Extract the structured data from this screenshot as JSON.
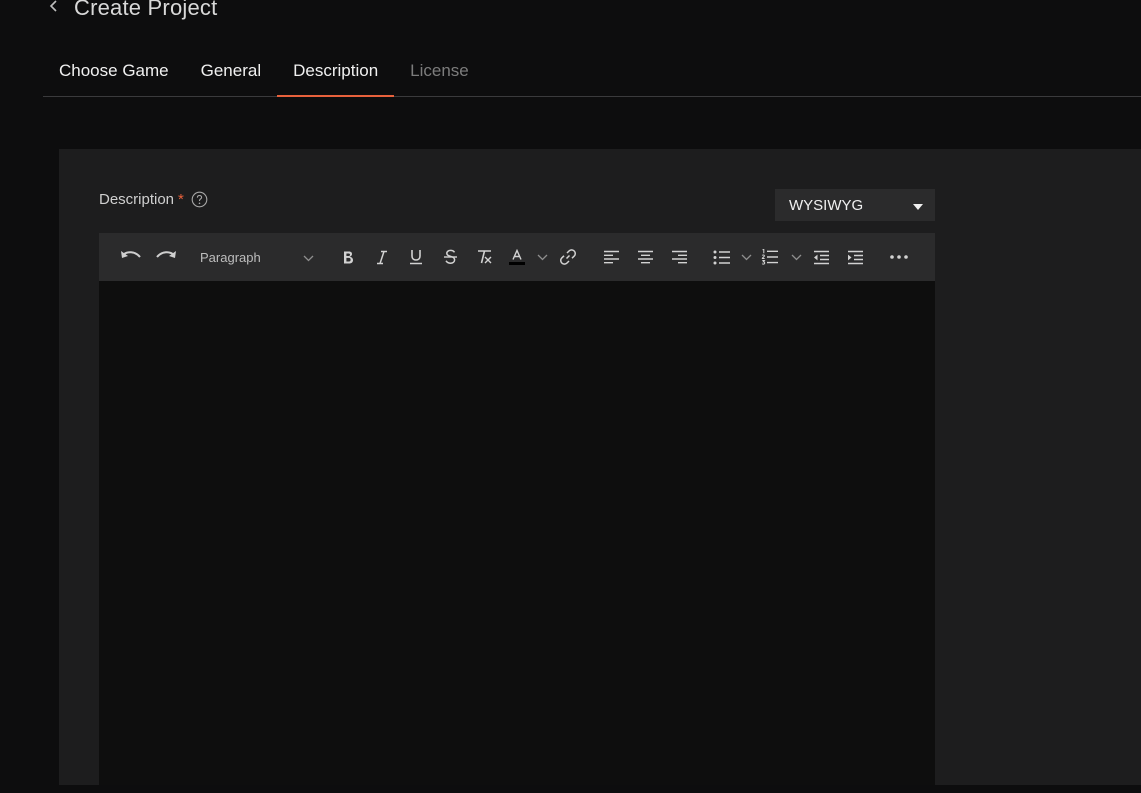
{
  "header": {
    "title": "Create Project",
    "back_icon": "chevron-left-icon"
  },
  "tabs": [
    {
      "label": "Choose Game",
      "state": "normal"
    },
    {
      "label": "General",
      "state": "normal"
    },
    {
      "label": "Description",
      "state": "active"
    },
    {
      "label": "License",
      "state": "disabled"
    }
  ],
  "form": {
    "field_label": "Description",
    "required_marker": "*",
    "help_icon": "question-circle-icon",
    "editor_mode": "WYSIWYG",
    "editor_content": ""
  },
  "toolbar": {
    "block_format": "Paragraph",
    "icons": [
      "undo-icon",
      "redo-icon",
      "bold-icon",
      "italic-icon",
      "underline-icon",
      "strikethrough-icon",
      "clear-formatting-icon",
      "text-color-icon",
      "link-icon",
      "align-left-icon",
      "align-center-icon",
      "align-right-icon",
      "bullet-list-icon",
      "numbered-list-icon",
      "outdent-icon",
      "indent-icon",
      "more-icon"
    ]
  },
  "colors": {
    "background": "#0d0d0e",
    "card": "#1d1d1e",
    "toolbar": "#2b2b2c",
    "accent": "#e8613c",
    "tab_disabled": "#7c7c7c"
  }
}
